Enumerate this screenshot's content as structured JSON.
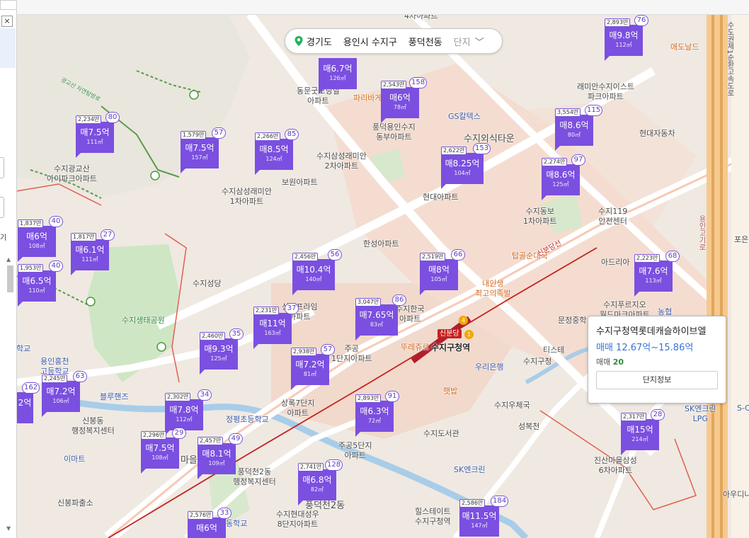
{
  "breadcrumb": {
    "province": "경기도",
    "city": "용인시 수지구",
    "dong": "풍덕천동",
    "complex": "단지"
  },
  "left_panel": {
    "close_glyph": "×",
    "snippet": "기"
  },
  "popup": {
    "title": "수지구청역롯데캐슬하이브엘",
    "price_range": "매매 12.67억~15.86억",
    "count_label": "매매",
    "count_value": "20",
    "button_label": "단지정보"
  },
  "station": {
    "name": "수지구청역",
    "line_badge": "신분당",
    "line_label": "신분당선",
    "numbers": [
      "4",
      "1"
    ]
  },
  "markers": [
    {
      "unit": "",
      "price": "매6.7억",
      "area": "126㎡",
      "count": ""
    },
    {
      "unit": "2,543만",
      "price": "매6억",
      "area": "78㎡",
      "count": "158"
    },
    {
      "unit": "2,893만",
      "price": "매9.8억",
      "area": "112㎡",
      "count": "76"
    },
    {
      "unit": "2,234만",
      "price": "매7.5억",
      "area": "111㎡",
      "count": "80"
    },
    {
      "unit": "1,579만",
      "price": "매7.5억",
      "area": "157㎡",
      "count": "57"
    },
    {
      "unit": "2,266만",
      "price": "매8.5억",
      "area": "124㎡",
      "count": "85"
    },
    {
      "unit": "3,554만",
      "price": "매8.6억",
      "area": "80㎡",
      "count": "115"
    },
    {
      "unit": "2,622만",
      "price": "매8.25억",
      "area": "104㎡",
      "count": "153"
    },
    {
      "unit": "2,274만",
      "price": "매8.6억",
      "area": "125㎡",
      "count": "97"
    },
    {
      "unit": "1,837만",
      "price": "매6억",
      "area": "108㎡",
      "count": "40"
    },
    {
      "unit": "1,817만",
      "price": "매6.1억",
      "area": "111㎡",
      "count": "27"
    },
    {
      "unit": "1,953만",
      "price": "매6.5억",
      "area": "110㎡",
      "count": "40"
    },
    {
      "unit": "2,456만",
      "price": "매10.4억",
      "area": "140㎡",
      "count": "56"
    },
    {
      "unit": "2,519만",
      "price": "매8억",
      "area": "105㎡",
      "count": "66"
    },
    {
      "unit": "2,223만",
      "price": "매7.6억",
      "area": "113㎡",
      "count": "68"
    },
    {
      "unit": "3,047만",
      "price": "매7.65억",
      "area": "83㎡",
      "count": "86"
    },
    {
      "unit": "2,231만",
      "price": "매11억",
      "area": "163㎡",
      "count": "37"
    },
    {
      "unit": "2,460만",
      "price": "매9.3억",
      "area": "125㎡",
      "count": "35"
    },
    {
      "unit": "2,938만",
      "price": "매7.2억",
      "area": "81㎡",
      "count": "57"
    },
    {
      "unit": "2,245만",
      "price": "매7.2억",
      "area": "106㎡",
      "count": "63"
    },
    {
      "unit": "",
      "price": "2억",
      "area": "",
      "count": "162"
    },
    {
      "unit": "2,302만",
      "price": "매7.8억",
      "area": "112㎡",
      "count": "34"
    },
    {
      "unit": "2,893만",
      "price": "매6.3억",
      "area": "72㎡",
      "count": "91"
    },
    {
      "unit": "2,296만",
      "price": "매7.5억",
      "area": "108㎡",
      "count": "29"
    },
    {
      "unit": "2,457만",
      "price": "매8.1억",
      "area": "109㎡",
      "count": "49"
    },
    {
      "unit": "2,317만",
      "price": "매15억",
      "area": "214㎡",
      "count": "28"
    },
    {
      "unit": "2,741만",
      "price": "매6.8억",
      "area": "82㎡",
      "count": "128"
    },
    {
      "unit": "2,576만",
      "price": "매6억",
      "area": "",
      "count": "33"
    },
    {
      "unit": "2,586만",
      "price": "매11.5억",
      "area": "147㎡",
      "count": "184"
    }
  ],
  "places": [
    {
      "text": "4차아파트",
      "kind": "normal"
    },
    {
      "text": "동문굿모닝힐\n아파트",
      "kind": "normal"
    },
    {
      "text": "파리바게",
      "kind": "orange"
    },
    {
      "text": "GS칼텍스",
      "kind": "blue"
    },
    {
      "text": "풍덕용인수지\n동부아파트",
      "kind": "normal"
    },
    {
      "text": "수지외식타운",
      "kind": "normal"
    },
    {
      "text": "래미안수지이스트\n파크아파트",
      "kind": "normal"
    },
    {
      "text": "현대자동차",
      "kind": "normal"
    },
    {
      "text": "애도날드",
      "kind": "orange"
    },
    {
      "text": "수지광교산\n아이파크아파트",
      "kind": "normal"
    },
    {
      "text": "수지삼성래미안\n2차아파트",
      "kind": "normal"
    },
    {
      "text": "보원아파트",
      "kind": "normal"
    },
    {
      "text": "수지삼성래미안\n1차아파트",
      "kind": "normal"
    },
    {
      "text": "현대아파트",
      "kind": "normal"
    },
    {
      "text": "수지동보\n1차아파트",
      "kind": "normal"
    },
    {
      "text": "수지119\n안전센터",
      "kind": "normal"
    },
    {
      "text": "한성아파트",
      "kind": "normal"
    },
    {
      "text": "탑골순대국",
      "kind": "orange"
    },
    {
      "text": "아드리아",
      "kind": "normal"
    },
    {
      "text": "수지성당",
      "kind": "normal"
    },
    {
      "text": "내인생\n최고의족발",
      "kind": "orange"
    },
    {
      "text": "수지생태공원",
      "kind": "green"
    },
    {
      "text": "신정프라임\n아파트",
      "kind": "normal"
    },
    {
      "text": "수지한국\n아파트",
      "kind": "normal"
    },
    {
      "text": "수지푸르지오\n월드마크아파트",
      "kind": "normal"
    },
    {
      "text": "문정중학",
      "kind": "normal"
    },
    {
      "text": "농협",
      "kind": "blue"
    },
    {
      "text": "용인홍천\n고등학교",
      "kind": "blue"
    },
    {
      "text": "주공\n1단지아파트",
      "kind": "normal"
    },
    {
      "text": "뚜레쥬르",
      "kind": "orange"
    },
    {
      "text": "우리은행",
      "kind": "blue"
    },
    {
      "text": "수지구청",
      "kind": "normal"
    },
    {
      "text": "티스테",
      "kind": "normal"
    },
    {
      "text": "햇밥",
      "kind": "orange"
    },
    {
      "text": "수지우체국",
      "kind": "normal"
    },
    {
      "text": "블루핸즈",
      "kind": "blue"
    },
    {
      "text": "신봉동\n행정복지센터",
      "kind": "normal"
    },
    {
      "text": "상록7단지\n아파트",
      "kind": "normal"
    },
    {
      "text": "정평초등학교",
      "kind": "blue"
    },
    {
      "text": "성복천",
      "kind": "normal"
    },
    {
      "text": "SK엔크린\nLPG",
      "kind": "blue"
    },
    {
      "text": "이마트",
      "kind": "blue"
    },
    {
      "text": "마을",
      "kind": "normal"
    },
    {
      "text": "풍덕천2동\n행정복지센터",
      "kind": "normal"
    },
    {
      "text": "주공5단지\n아파트",
      "kind": "normal"
    },
    {
      "text": "수지도서관",
      "kind": "normal"
    },
    {
      "text": "SK엔크린",
      "kind": "blue"
    },
    {
      "text": "진산마을삼성\n6차아파트",
      "kind": "normal"
    },
    {
      "text": "신봉파출소",
      "kind": "normal"
    },
    {
      "text": "풍덕천2동",
      "kind": "normal"
    },
    {
      "text": "수지현대성우\n8단지아파트",
      "kind": "normal"
    },
    {
      "text": "힐스테이트\n수지구청역",
      "kind": "normal"
    },
    {
      "text": "동학교",
      "kind": "blue"
    },
    {
      "text": "학교",
      "kind": "blue"
    },
    {
      "text": "아우디나",
      "kind": "normal"
    },
    {
      "text": "포은",
      "kind": "normal"
    },
    {
      "text": "S-C",
      "kind": "blue"
    }
  ],
  "road_labels": {
    "highway": "수도권제1순환고속도로",
    "local": "용인고기로",
    "trail": "광교산 자연탐방로",
    "subway": "신분당선"
  }
}
